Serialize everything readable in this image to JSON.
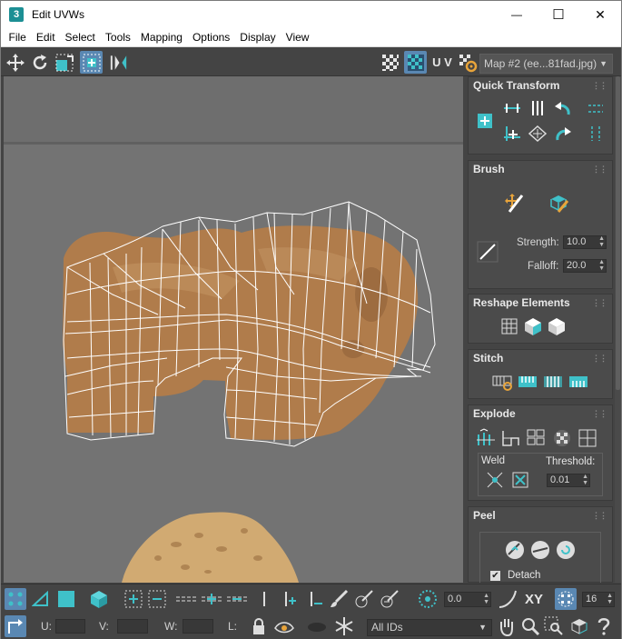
{
  "window": {
    "title": "Edit UVWs",
    "app_icon_text": "3",
    "minimize": "—",
    "maximize": "☐",
    "close": "✕"
  },
  "menu": [
    "File",
    "Edit",
    "Select",
    "Tools",
    "Mapping",
    "Options",
    "Display",
    "View"
  ],
  "toolbar": {
    "uv_label": "U V",
    "map_selector": "Map #2 (ee...81fad.jpg)"
  },
  "panel": {
    "quick_transform": {
      "title": "Quick Transform"
    },
    "brush": {
      "title": "Brush",
      "strength_label": "Strength:",
      "strength_value": "10.0",
      "falloff_label": "Falloff:",
      "falloff_value": "20.0"
    },
    "reshape": {
      "title": "Reshape Elements"
    },
    "stitch": {
      "title": "Stitch"
    },
    "explode": {
      "title": "Explode",
      "weld_label": "Weld",
      "threshold_label": "Threshold:",
      "threshold_value": "0.01"
    },
    "peel": {
      "title": "Peel",
      "detach_label": "Detach",
      "detach_checked": true
    }
  },
  "bottom": {
    "rotate_value": "0.0",
    "xy_label": "XY",
    "grid_value": "16",
    "u_label": "U:",
    "v_label": "V:",
    "w_label": "W:",
    "l_label": "L:",
    "ids_value": "All IDs"
  },
  "colors": {
    "accent": "#3fc1c9",
    "selection_blue": "#5a88b3",
    "background": "#444444"
  }
}
